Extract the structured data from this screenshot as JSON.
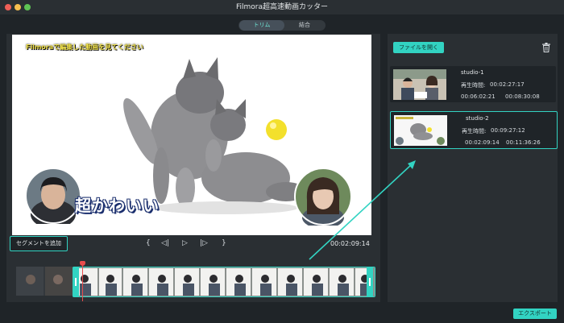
{
  "window": {
    "title": "Filmora超高速動画カッター"
  },
  "tabs": [
    {
      "label": "トリム",
      "active": true
    },
    {
      "label": "結合",
      "active": false
    }
  ],
  "preview": {
    "caption_top": "Filmoraで編集した動画を見てください",
    "caption_bottom": "超かわいい"
  },
  "controls": {
    "add_segment_label": "セグメントを追加",
    "prev_marker": "{",
    "prev_frame": "◁|",
    "play": "▷",
    "next_frame": "|▷",
    "next_marker": "}",
    "timecode": "00:02:09:14"
  },
  "library": {
    "open_file_label": "ファイルを開く",
    "items": [
      {
        "name": "studio-1",
        "duration_label": "再生時間:",
        "duration": "00:02:27:17",
        "in": "00:06:02:21",
        "out": "00:08:30:08",
        "selected": false
      },
      {
        "name": "studio-2",
        "duration_label": "再生時間:",
        "duration": "00:09:27:12",
        "in": "00:02:09:14",
        "out": "00:11:36:26",
        "selected": true
      }
    ]
  },
  "export_label": "エクスポート",
  "colors": {
    "accent": "#32d3c2",
    "playhead": "#e94c4c",
    "panel": "#2a2f33",
    "background": "#1f2428"
  }
}
